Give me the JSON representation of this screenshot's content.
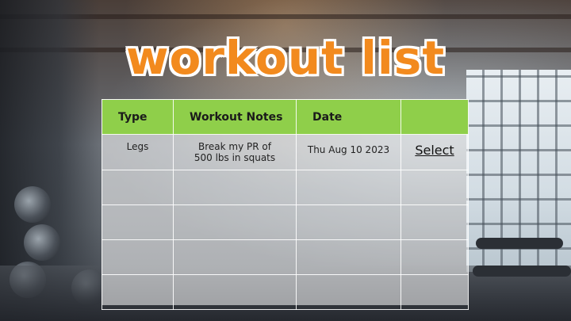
{
  "title": "workout list",
  "table": {
    "headers": [
      "Type",
      "Workout Notes",
      "Date",
      ""
    ],
    "rows": [
      {
        "type": "Legs",
        "notes_line1": "Break my PR of",
        "notes_line2": "500 lbs in squats",
        "date": "Thu Aug 10 2023",
        "action": "Select"
      },
      {
        "type": "",
        "notes_line1": "",
        "notes_line2": "",
        "date": "",
        "action": ""
      },
      {
        "type": "",
        "notes_line1": "",
        "notes_line2": "",
        "date": "",
        "action": ""
      },
      {
        "type": "",
        "notes_line1": "",
        "notes_line2": "",
        "date": "",
        "action": ""
      },
      {
        "type": "",
        "notes_line1": "",
        "notes_line2": "",
        "date": "",
        "action": ""
      }
    ]
  },
  "colors": {
    "title": "#f28a1e",
    "header_bg": "#8fcf4a"
  }
}
